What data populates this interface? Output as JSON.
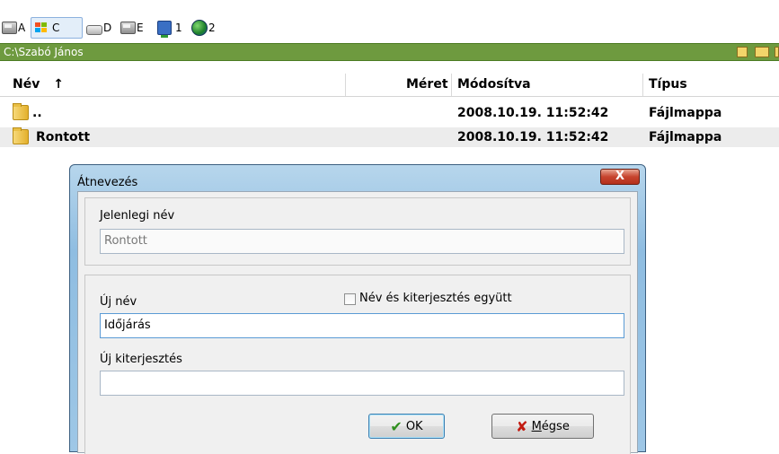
{
  "drives": [
    {
      "label": "A",
      "icon": "floppy-drive-icon"
    },
    {
      "label": "C",
      "icon": "windows-drive-icon",
      "active": true
    },
    {
      "label": "D",
      "icon": "cd-drive-icon"
    },
    {
      "label": "E",
      "icon": "removable-drive-icon"
    },
    {
      "label": "1",
      "icon": "network-drive-icon"
    },
    {
      "label": "2",
      "icon": "ftp-globe-icon"
    }
  ],
  "path": "C:\\Szabó János",
  "columns": {
    "name": "Név",
    "sort_indicator": "↑",
    "size": "Méret",
    "modified": "Módosítva",
    "type": "Típus"
  },
  "rows": [
    {
      "name": "..",
      "modified": "2008.10.19. 11:52:42",
      "type": "Fájlmappa"
    },
    {
      "name": "Rontott",
      "modified": "2008.10.19. 11:52:42",
      "type": "Fájlmappa"
    }
  ],
  "dialog": {
    "title": "Átnevezés",
    "close_glyph": "X",
    "current_name_label": "Jelenlegi név",
    "current_name_value": "Rontott",
    "new_name_label": "Új név",
    "new_name_value": "Időjárás",
    "checkbox_label": "Név és kiterjesztés együtt",
    "checkbox_checked": false,
    "new_ext_label": "Új kiterjesztés",
    "new_ext_value": "",
    "ok_label": "OK",
    "cancel_mnemonic": "M",
    "cancel_rest": "égse"
  },
  "colors": {
    "path_bar": "#6e9a3f",
    "dialog_frame": "#9ec7e6",
    "close_button": "#c7442e"
  }
}
